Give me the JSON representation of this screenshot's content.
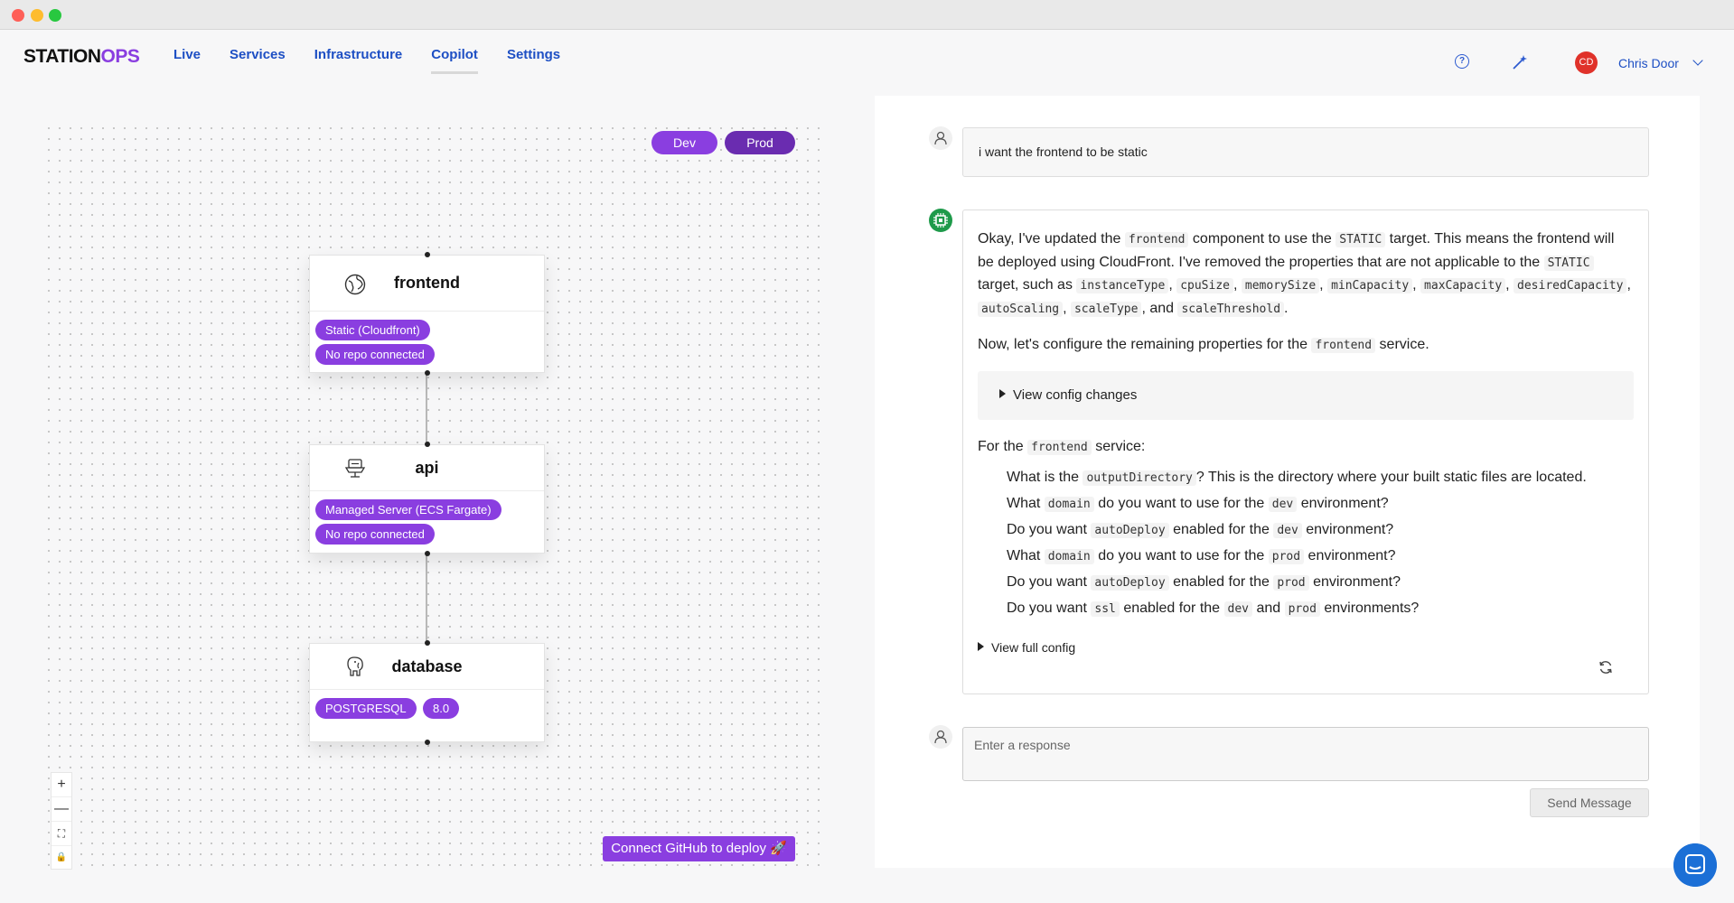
{
  "app": {
    "logo_main": "STATION",
    "logo_accent": "OPS",
    "accent_color": "#8a3ee0"
  },
  "nav": {
    "items": [
      {
        "label": "Live"
      },
      {
        "label": "Services"
      },
      {
        "label": "Infrastructure"
      },
      {
        "label": "Copilot"
      },
      {
        "label": "Settings"
      }
    ],
    "active": "Copilot"
  },
  "header": {
    "help_icon": "question-circle-icon",
    "wand_icon": "magic-wand-icon",
    "avatar_initials": "CD",
    "user_name": "Chris Door"
  },
  "canvas": {
    "env": {
      "dev": "Dev",
      "prod": "Prod"
    },
    "nodes": [
      {
        "title": "frontend",
        "icon": "globe-icon",
        "tags": [
          "Static (Cloudfront)",
          "No repo connected"
        ]
      },
      {
        "title": "api",
        "icon": "server-icon",
        "tags": [
          "Managed Server (ECS Fargate)",
          "No repo connected"
        ]
      },
      {
        "title": "database",
        "icon": "postgres-elephant-icon",
        "tags": [
          "POSTGRESQL",
          "8.0"
        ]
      }
    ],
    "zoom_controls": [
      "+",
      "—",
      "⛶",
      "🔒"
    ],
    "connect_button": "Connect GitHub to deploy 🚀"
  },
  "chat": {
    "user_message": "i want the frontend to be static",
    "bot": {
      "p1_parts": [
        "Okay, I've updated the ",
        "frontend",
        " component to use the ",
        "STATIC",
        " target. This means the frontend will be deployed using CloudFront. I've removed the properties that are not applicable to the ",
        "STATIC",
        " target, such as ",
        "instanceType",
        ", ",
        "cpuSize",
        ", ",
        "memorySize",
        ", ",
        "minCapacity",
        ", ",
        "maxCapacity",
        ", ",
        "desiredCapacity",
        ", ",
        "autoScaling",
        ", ",
        "scaleType",
        ", and ",
        "scaleThreshold",
        "."
      ],
      "p2_parts": [
        "Now, let's configure the remaining properties for the ",
        "frontend",
        " service."
      ],
      "details_label": "View config changes",
      "p3_parts": [
        "For the ",
        "frontend",
        " service:"
      ],
      "questions": [
        [
          "What is the ",
          "outputDirectory",
          "? This is the directory where your built static files are located."
        ],
        [
          "What ",
          "domain",
          " do you want to use for the ",
          "dev",
          " environment?"
        ],
        [
          "Do you want ",
          "autoDeploy",
          " enabled for the ",
          "dev",
          " environment?"
        ],
        [
          "What ",
          "domain",
          " do you want to use for the ",
          "prod",
          " environment?"
        ],
        [
          "Do you want ",
          "autoDeploy",
          " enabled for the ",
          "prod",
          " environment?"
        ],
        [
          "Do you want ",
          "ssl",
          " enabled for the ",
          "dev",
          " and ",
          "prod",
          " environments?"
        ]
      ],
      "full_config_label": "View full config"
    },
    "input_placeholder": "Enter a response",
    "send_label": "Send Message"
  }
}
